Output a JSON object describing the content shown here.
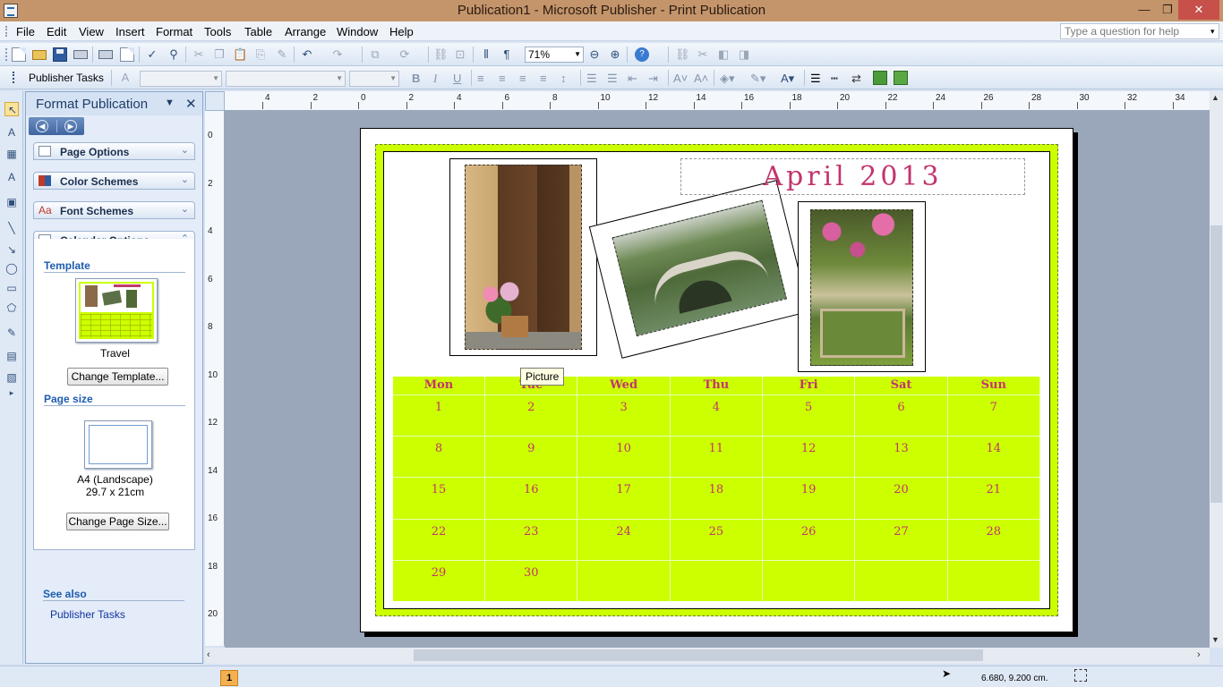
{
  "window": {
    "title": "Publication1 - Microsoft Publisher - Print Publication",
    "minimize": "—",
    "restore": "❐",
    "close": "✕"
  },
  "menu": [
    "File",
    "Edit",
    "View",
    "Insert",
    "Format",
    "Tools",
    "Table",
    "Arrange",
    "Window",
    "Help"
  ],
  "help_box": {
    "placeholder": "Type a question for help"
  },
  "toolbar": {
    "zoom": "71%",
    "publisher_tasks": "Publisher Tasks"
  },
  "task_pane": {
    "title": "Format Publication",
    "sections": [
      "Page Options",
      "Color Schemes",
      "Font Schemes",
      "Calendar Options"
    ],
    "template_heading": "Template",
    "template_name": "Travel",
    "change_template": "Change Template...",
    "page_size_heading": "Page size",
    "page_size_name": "A4 (Landscape)",
    "page_size_dims": "29.7 x 21cm",
    "change_page_size": "Change Page Size...",
    "see_also": "See also",
    "link_publisher_tasks": "Publisher Tasks"
  },
  "ruler": {
    "horizontal": [
      "4",
      "2",
      "0",
      "2",
      "4",
      "6",
      "8",
      "10",
      "12",
      "14",
      "16",
      "18",
      "20",
      "22",
      "24",
      "26",
      "28",
      "30",
      "32",
      "34"
    ],
    "vertical": [
      "0",
      "2",
      "4",
      "6",
      "8",
      "10",
      "12",
      "14",
      "16",
      "18",
      "20"
    ]
  },
  "calendar": {
    "title": "April 2013",
    "days": [
      "Mon",
      "Tue",
      "Wed",
      "Thu",
      "Fri",
      "Sat",
      "Sun"
    ],
    "weeks": [
      [
        "1",
        "2",
        "3",
        "4",
        "5",
        "6",
        "7"
      ],
      [
        "8",
        "9",
        "10",
        "11",
        "12",
        "13",
        "14"
      ],
      [
        "15",
        "16",
        "17",
        "18",
        "19",
        "20",
        "21"
      ],
      [
        "22",
        "23",
        "24",
        "25",
        "26",
        "27",
        "28"
      ],
      [
        "29",
        "30",
        "",
        "",
        "",
        "",
        ""
      ]
    ]
  },
  "tooltip": "Picture",
  "status": {
    "page": "1",
    "coords": "6.680, 9.200 cm."
  },
  "colors": {
    "accent_green": "#ccff00",
    "calendar_text": "#c1356f",
    "titlebar": "#c4946b"
  }
}
